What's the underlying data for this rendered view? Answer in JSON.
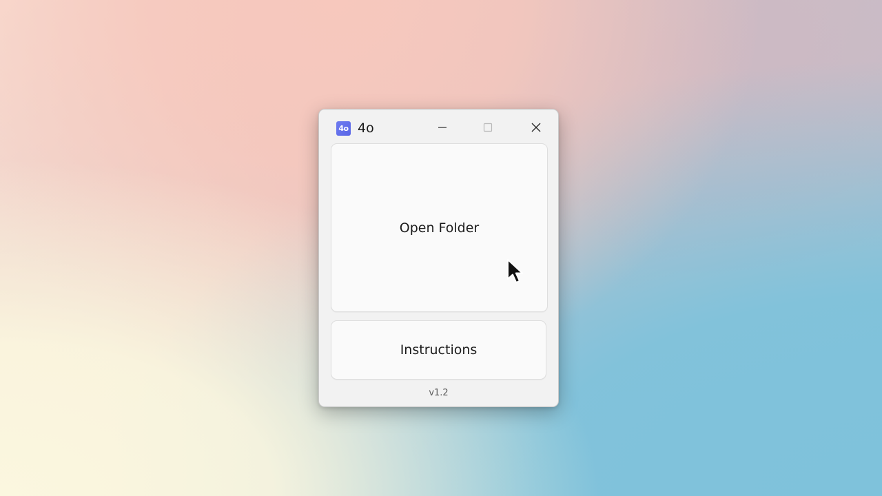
{
  "window": {
    "title": "4o",
    "icon": {
      "name": "app-logo-icon",
      "text": "4o",
      "color": "#5f6ceb"
    },
    "controls": {
      "minimize_icon": "minimize-icon",
      "maximize_icon": "maximize-icon",
      "close_icon": "close-icon"
    }
  },
  "main": {
    "open_folder_label": "Open Folder",
    "instructions_label": "Instructions"
  },
  "footer": {
    "version": "v1.2"
  },
  "cursor": {
    "icon": "mouse-pointer-icon"
  },
  "colors": {
    "accent": "#5f6ceb",
    "window_background": "#f2f2f2",
    "button_background": "#fafafa"
  }
}
